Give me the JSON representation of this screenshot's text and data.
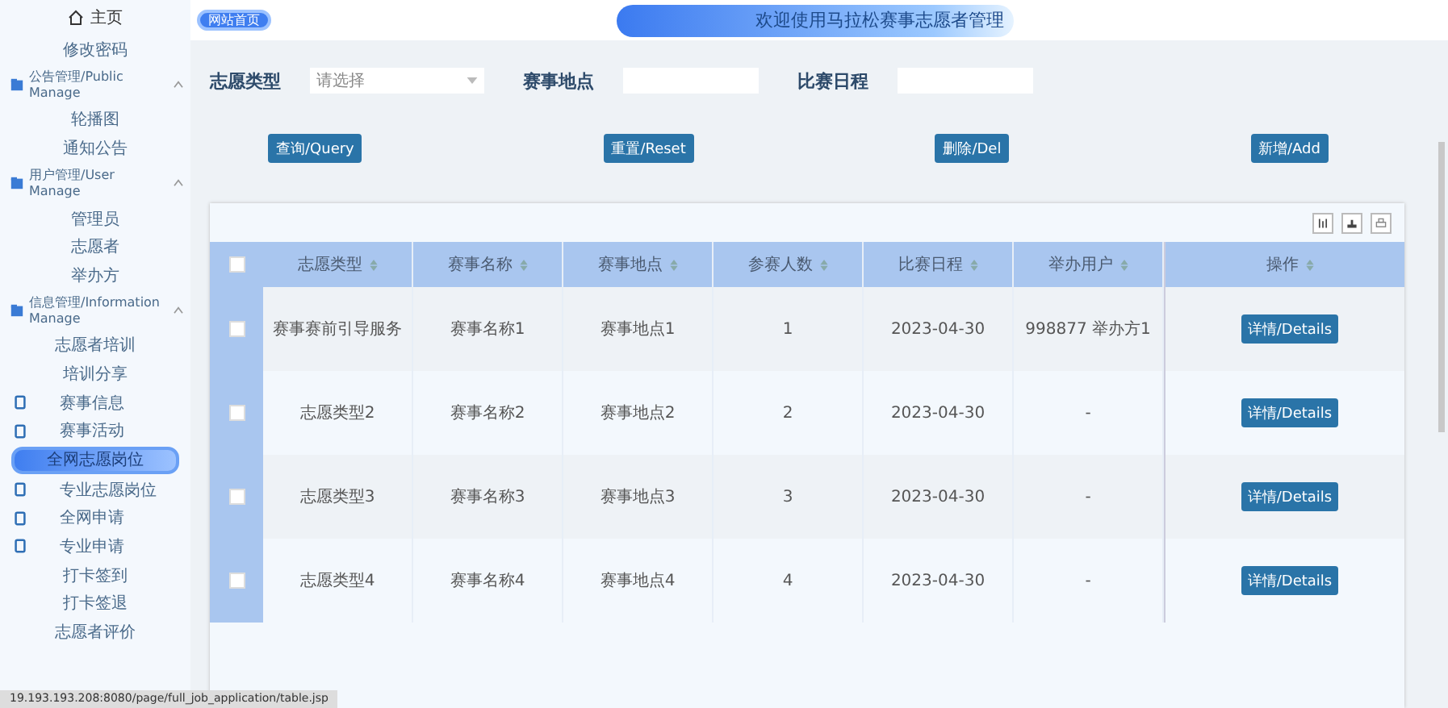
{
  "header": {
    "home_button": "网站首页",
    "banner_title": "欢迎使用马拉松赛事志愿者管理"
  },
  "sidebar": {
    "home": "主页",
    "items": [
      {
        "kind": "link",
        "label": "修改密码",
        "selected": false
      },
      {
        "kind": "group",
        "label": "公告管理/Public Manage",
        "expanded": true,
        "children": [
          {
            "kind": "plain",
            "label": "轮播图",
            "selected": false
          },
          {
            "kind": "plain",
            "label": "通知公告",
            "selected": false
          }
        ]
      },
      {
        "kind": "group",
        "label": "用户管理/User Manage",
        "expanded": true,
        "children": [
          {
            "kind": "plain",
            "label": "管理员",
            "selected": false
          },
          {
            "kind": "plain",
            "label": "志愿者",
            "selected": false
          },
          {
            "kind": "plain",
            "label": "举办方",
            "selected": false
          }
        ]
      },
      {
        "kind": "group",
        "label": "信息管理/Information Manage",
        "expanded": true,
        "children": [
          {
            "kind": "plain",
            "label": "志愿者培训",
            "selected": false
          },
          {
            "kind": "plain",
            "label": "培训分享",
            "selected": false
          },
          {
            "kind": "iconed",
            "label": "赛事信息",
            "selected": false
          },
          {
            "kind": "iconed",
            "label": "赛事活动",
            "selected": false
          },
          {
            "kind": "plain",
            "label": "全网志愿岗位",
            "selected": true
          },
          {
            "kind": "iconed",
            "label": "专业志愿岗位",
            "selected": false
          },
          {
            "kind": "iconed",
            "label": "全网申请",
            "selected": false
          },
          {
            "kind": "iconed",
            "label": "专业申请",
            "selected": false
          },
          {
            "kind": "plain",
            "label": "打卡签到",
            "selected": false
          },
          {
            "kind": "plain",
            "label": "打卡签退",
            "selected": false
          },
          {
            "kind": "plain",
            "label": "志愿者评价",
            "selected": false
          }
        ]
      }
    ]
  },
  "filters": [
    {
      "kind": "select",
      "label": "志愿类型",
      "placeholder": "请选择"
    },
    {
      "kind": "text",
      "label": "赛事地点"
    },
    {
      "kind": "text",
      "label": "比赛日程"
    }
  ],
  "actions": [
    "查询/Query",
    "重置/Reset",
    "删除/Del",
    "新增/Add"
  ],
  "table": {
    "select_all": false,
    "columns": [
      {
        "label": "志愿类型",
        "sortable": true
      },
      {
        "label": "赛事名称",
        "sortable": true
      },
      {
        "label": "赛事地点",
        "sortable": true
      },
      {
        "label": "参赛人数",
        "sortable": true
      },
      {
        "label": "比赛日程",
        "sortable": true
      },
      {
        "label": "举办用户",
        "sortable": true
      },
      {
        "label": "操作",
        "sortable": true
      }
    ],
    "rows": [
      {
        "checked": false,
        "cells": [
          "赛事赛前引导服务",
          "赛事名称1",
          "赛事地点1",
          "1",
          "2023-04-30",
          "998877 举办方1"
        ],
        "action": "详情/Details"
      },
      {
        "checked": false,
        "cells": [
          "志愿类型2",
          "赛事名称2",
          "赛事地点2",
          "2",
          "2023-04-30",
          "-"
        ],
        "action": "详情/Details"
      },
      {
        "checked": false,
        "cells": [
          "志愿类型3",
          "赛事名称3",
          "赛事地点3",
          "3",
          "2023-04-30",
          "-"
        ],
        "action": "详情/Details"
      },
      {
        "checked": false,
        "cells": [
          "志愿类型4",
          "赛事名称4",
          "赛事地点4",
          "4",
          "2023-04-30",
          "-"
        ],
        "action": "详情/Details"
      }
    ]
  },
  "status_bar": {
    "url": "19.193.193.208:8080/page/full_job_application/table.jsp"
  }
}
